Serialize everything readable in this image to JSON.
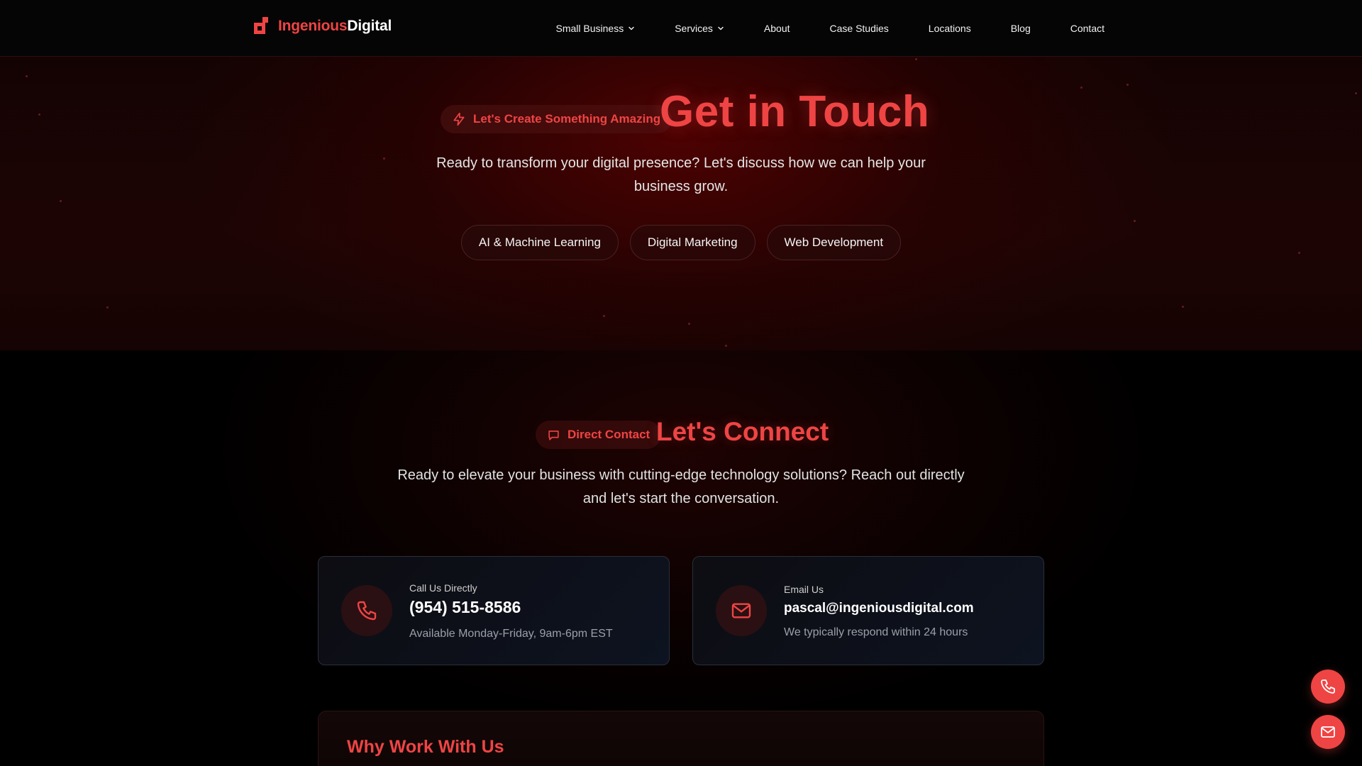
{
  "brand": {
    "name_part1": "Ingenious",
    "name_part2": "Digital",
    "accent": "#ef4444"
  },
  "nav": {
    "items": [
      {
        "label": "Small Business",
        "has_dropdown": true
      },
      {
        "label": "Services",
        "has_dropdown": true
      },
      {
        "label": "About",
        "has_dropdown": false
      },
      {
        "label": "Case Studies",
        "has_dropdown": false
      },
      {
        "label": "Locations",
        "has_dropdown": false
      },
      {
        "label": "Blog",
        "has_dropdown": false
      },
      {
        "label": "Contact",
        "has_dropdown": false
      }
    ]
  },
  "hero": {
    "badge": "Let's Create Something Amazing",
    "badge_icon": "lightning-icon",
    "title": "Get in Touch",
    "subtitle": "Ready to transform your digital presence? Let's discuss how we can help your business grow.",
    "pills": [
      "AI & Machine Learning",
      "Digital Marketing",
      "Web Development"
    ]
  },
  "connect": {
    "badge": "Direct Contact",
    "badge_icon": "chat-bubble-icon",
    "title": "Let's Connect",
    "subtitle": "Ready to elevate your business with cutting-edge technology solutions? Reach out directly and let's start the conversation.",
    "phone_card": {
      "icon": "phone-icon",
      "label": "Call Us Directly",
      "value": "(954) 515-8586",
      "note": "Available Monday-Friday, 9am-6pm EST"
    },
    "email_card": {
      "icon": "mail-icon",
      "label": "Email Us",
      "value": "pascal@ingeniousdigital.com",
      "note": "We typically respond within 24 hours"
    },
    "why_title": "Why Work With Us"
  },
  "floating": {
    "call_icon": "phone-icon",
    "mail_icon": "mail-icon"
  }
}
